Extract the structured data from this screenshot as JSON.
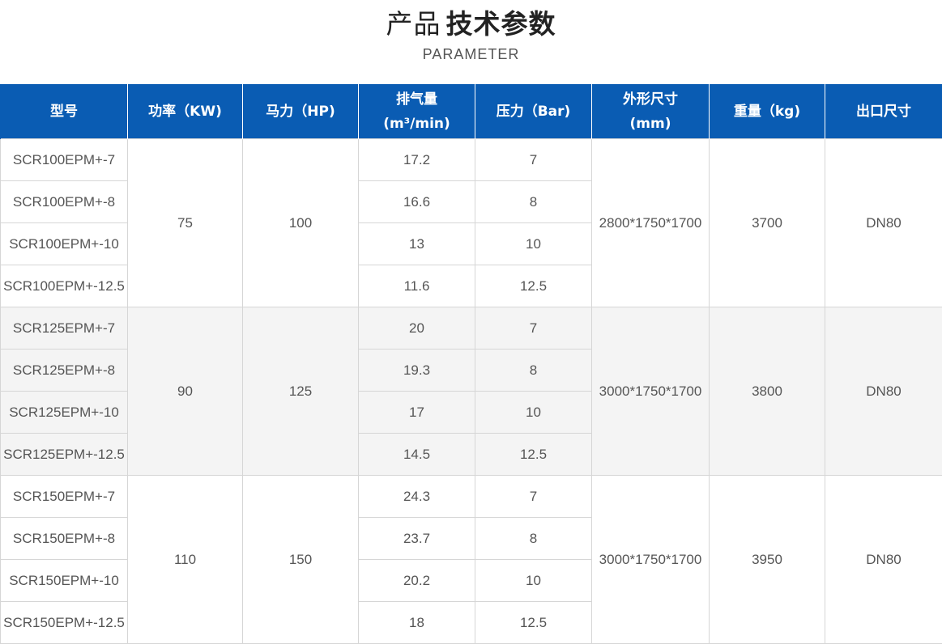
{
  "header": {
    "title_light": "产品",
    "title_bold": "技术参数",
    "subtitle": "PARAMETER"
  },
  "colors": {
    "header_bg": "#0a5cb3",
    "stripe_bg": "#f4f4f4",
    "border": "#d6d6d6"
  },
  "table": {
    "headers": [
      {
        "lines": [
          "型号"
        ]
      },
      {
        "lines": [
          "功率（KW)"
        ]
      },
      {
        "lines": [
          "马力（HP)"
        ]
      },
      {
        "lines": [
          "排气量",
          "(m³/min)"
        ]
      },
      {
        "lines": [
          "压力（Bar)"
        ]
      },
      {
        "lines": [
          "外形尺寸",
          "(mm)"
        ]
      },
      {
        "lines": [
          "重量（kg)"
        ]
      },
      {
        "lines": [
          "出口尺寸"
        ]
      }
    ],
    "groups": [
      {
        "power_kw": "75",
        "horsepower": "100",
        "dimensions": "2800*1750*1700",
        "weight": "3700",
        "outlet": "DN80",
        "rows": [
          {
            "model": "SCR100EPM+-7",
            "displacement": "17.2",
            "pressure": "7"
          },
          {
            "model": "SCR100EPM+-8",
            "displacement": "16.6",
            "pressure": "8"
          },
          {
            "model": "SCR100EPM+-10",
            "displacement": "13",
            "pressure": "10"
          },
          {
            "model": "SCR100EPM+-12.5",
            "displacement": "11.6",
            "pressure": "12.5"
          }
        ]
      },
      {
        "power_kw": "90",
        "horsepower": "125",
        "dimensions": "3000*1750*1700",
        "weight": "3800",
        "outlet": "DN80",
        "rows": [
          {
            "model": "SCR125EPM+-7",
            "displacement": "20",
            "pressure": "7"
          },
          {
            "model": "SCR125EPM+-8",
            "displacement": "19.3",
            "pressure": "8"
          },
          {
            "model": "SCR125EPM+-10",
            "displacement": "17",
            "pressure": "10"
          },
          {
            "model": "SCR125EPM+-12.5",
            "displacement": "14.5",
            "pressure": "12.5"
          }
        ]
      },
      {
        "power_kw": "110",
        "horsepower": "150",
        "dimensions": "3000*1750*1700",
        "weight": "3950",
        "outlet": "DN80",
        "rows": [
          {
            "model": "SCR150EPM+-7",
            "displacement": "24.3",
            "pressure": "7"
          },
          {
            "model": "SCR150EPM+-8",
            "displacement": "23.7",
            "pressure": "8"
          },
          {
            "model": "SCR150EPM+-10",
            "displacement": "20.2",
            "pressure": "10"
          },
          {
            "model": "SCR150EPM+-12.5",
            "displacement": "18",
            "pressure": "12.5"
          }
        ]
      }
    ]
  }
}
